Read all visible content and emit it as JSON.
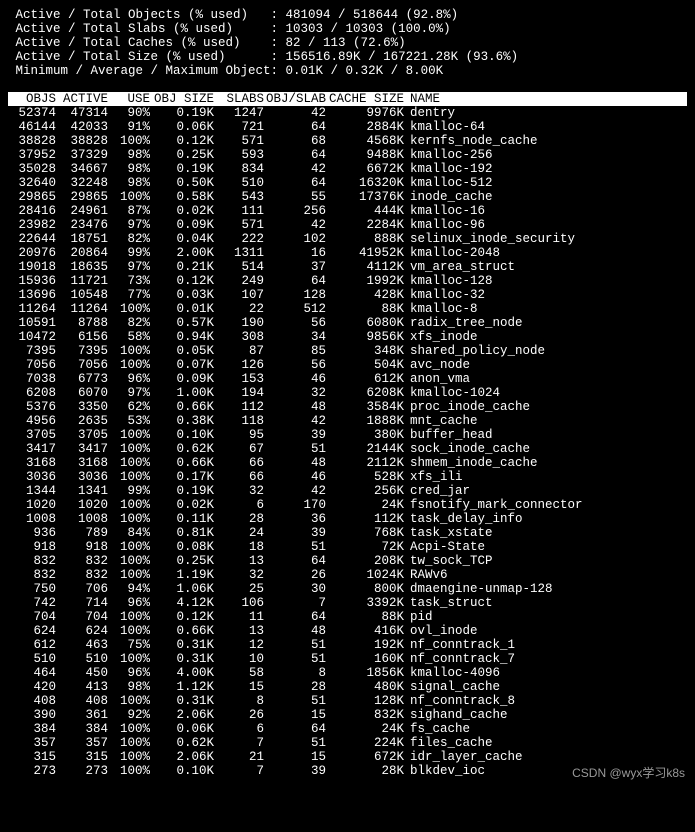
{
  "summary": [
    {
      "label": " Active / Total Objects (% used)   ",
      "value": ": 481094 / 518644 (92.8%)"
    },
    {
      "label": " Active / Total Slabs (% used)     ",
      "value": ": 10303 / 10303 (100.0%)"
    },
    {
      "label": " Active / Total Caches (% used)    ",
      "value": ": 82 / 113 (72.6%)"
    },
    {
      "label": " Active / Total Size (% used)      ",
      "value": ": 156516.89K / 167221.28K (93.6%)"
    },
    {
      "label": " Minimum / Average / Maximum Object",
      "value": ": 0.01K / 0.32K / 8.00K"
    }
  ],
  "headers": {
    "objs": "OBJS",
    "active": "ACTIVE",
    "use": "USE",
    "obj_size": "OBJ SIZE",
    "slabs": "SLABS",
    "obj_slab": "OBJ/SLAB",
    "cache_size": "CACHE SIZE",
    "name": "NAME"
  },
  "rows": [
    {
      "objs": "52374",
      "active": "47314",
      "use": "90%",
      "obj_size": "0.19K",
      "slabs": "1247",
      "obj_slab": "42",
      "cache_size": "9976K",
      "name": "dentry"
    },
    {
      "objs": "46144",
      "active": "42033",
      "use": "91%",
      "obj_size": "0.06K",
      "slabs": "721",
      "obj_slab": "64",
      "cache_size": "2884K",
      "name": "kmalloc-64"
    },
    {
      "objs": "38828",
      "active": "38828",
      "use": "100%",
      "obj_size": "0.12K",
      "slabs": "571",
      "obj_slab": "68",
      "cache_size": "4568K",
      "name": "kernfs_node_cache"
    },
    {
      "objs": "37952",
      "active": "37329",
      "use": "98%",
      "obj_size": "0.25K",
      "slabs": "593",
      "obj_slab": "64",
      "cache_size": "9488K",
      "name": "kmalloc-256"
    },
    {
      "objs": "35028",
      "active": "34667",
      "use": "98%",
      "obj_size": "0.19K",
      "slabs": "834",
      "obj_slab": "42",
      "cache_size": "6672K",
      "name": "kmalloc-192"
    },
    {
      "objs": "32640",
      "active": "32248",
      "use": "98%",
      "obj_size": "0.50K",
      "slabs": "510",
      "obj_slab": "64",
      "cache_size": "16320K",
      "name": "kmalloc-512"
    },
    {
      "objs": "29865",
      "active": "29865",
      "use": "100%",
      "obj_size": "0.58K",
      "slabs": "543",
      "obj_slab": "55",
      "cache_size": "17376K",
      "name": "inode_cache"
    },
    {
      "objs": "28416",
      "active": "24961",
      "use": "87%",
      "obj_size": "0.02K",
      "slabs": "111",
      "obj_slab": "256",
      "cache_size": "444K",
      "name": "kmalloc-16"
    },
    {
      "objs": "23982",
      "active": "23476",
      "use": "97%",
      "obj_size": "0.09K",
      "slabs": "571",
      "obj_slab": "42",
      "cache_size": "2284K",
      "name": "kmalloc-96"
    },
    {
      "objs": "22644",
      "active": "18751",
      "use": "82%",
      "obj_size": "0.04K",
      "slabs": "222",
      "obj_slab": "102",
      "cache_size": "888K",
      "name": "selinux_inode_security"
    },
    {
      "objs": "20976",
      "active": "20864",
      "use": "99%",
      "obj_size": "2.00K",
      "slabs": "1311",
      "obj_slab": "16",
      "cache_size": "41952K",
      "name": "kmalloc-2048"
    },
    {
      "objs": "19018",
      "active": "18635",
      "use": "97%",
      "obj_size": "0.21K",
      "slabs": "514",
      "obj_slab": "37",
      "cache_size": "4112K",
      "name": "vm_area_struct"
    },
    {
      "objs": "15936",
      "active": "11721",
      "use": "73%",
      "obj_size": "0.12K",
      "slabs": "249",
      "obj_slab": "64",
      "cache_size": "1992K",
      "name": "kmalloc-128"
    },
    {
      "objs": "13696",
      "active": "10548",
      "use": "77%",
      "obj_size": "0.03K",
      "slabs": "107",
      "obj_slab": "128",
      "cache_size": "428K",
      "name": "kmalloc-32"
    },
    {
      "objs": "11264",
      "active": "11264",
      "use": "100%",
      "obj_size": "0.01K",
      "slabs": "22",
      "obj_slab": "512",
      "cache_size": "88K",
      "name": "kmalloc-8"
    },
    {
      "objs": "10591",
      "active": "8788",
      "use": "82%",
      "obj_size": "0.57K",
      "slabs": "190",
      "obj_slab": "56",
      "cache_size": "6080K",
      "name": "radix_tree_node"
    },
    {
      "objs": "10472",
      "active": "6156",
      "use": "58%",
      "obj_size": "0.94K",
      "slabs": "308",
      "obj_slab": "34",
      "cache_size": "9856K",
      "name": "xfs_inode"
    },
    {
      "objs": "7395",
      "active": "7395",
      "use": "100%",
      "obj_size": "0.05K",
      "slabs": "87",
      "obj_slab": "85",
      "cache_size": "348K",
      "name": "shared_policy_node"
    },
    {
      "objs": "7056",
      "active": "7056",
      "use": "100%",
      "obj_size": "0.07K",
      "slabs": "126",
      "obj_slab": "56",
      "cache_size": "504K",
      "name": "avc_node"
    },
    {
      "objs": "7038",
      "active": "6773",
      "use": "96%",
      "obj_size": "0.09K",
      "slabs": "153",
      "obj_slab": "46",
      "cache_size": "612K",
      "name": "anon_vma"
    },
    {
      "objs": "6208",
      "active": "6070",
      "use": "97%",
      "obj_size": "1.00K",
      "slabs": "194",
      "obj_slab": "32",
      "cache_size": "6208K",
      "name": "kmalloc-1024"
    },
    {
      "objs": "5376",
      "active": "3350",
      "use": "62%",
      "obj_size": "0.66K",
      "slabs": "112",
      "obj_slab": "48",
      "cache_size": "3584K",
      "name": "proc_inode_cache"
    },
    {
      "objs": "4956",
      "active": "2635",
      "use": "53%",
      "obj_size": "0.38K",
      "slabs": "118",
      "obj_slab": "42",
      "cache_size": "1888K",
      "name": "mnt_cache"
    },
    {
      "objs": "3705",
      "active": "3705",
      "use": "100%",
      "obj_size": "0.10K",
      "slabs": "95",
      "obj_slab": "39",
      "cache_size": "380K",
      "name": "buffer_head"
    },
    {
      "objs": "3417",
      "active": "3417",
      "use": "100%",
      "obj_size": "0.62K",
      "slabs": "67",
      "obj_slab": "51",
      "cache_size": "2144K",
      "name": "sock_inode_cache"
    },
    {
      "objs": "3168",
      "active": "3168",
      "use": "100%",
      "obj_size": "0.66K",
      "slabs": "66",
      "obj_slab": "48",
      "cache_size": "2112K",
      "name": "shmem_inode_cache"
    },
    {
      "objs": "3036",
      "active": "3036",
      "use": "100%",
      "obj_size": "0.17K",
      "slabs": "66",
      "obj_slab": "46",
      "cache_size": "528K",
      "name": "xfs_ili"
    },
    {
      "objs": "1344",
      "active": "1341",
      "use": "99%",
      "obj_size": "0.19K",
      "slabs": "32",
      "obj_slab": "42",
      "cache_size": "256K",
      "name": "cred_jar"
    },
    {
      "objs": "1020",
      "active": "1020",
      "use": "100%",
      "obj_size": "0.02K",
      "slabs": "6",
      "obj_slab": "170",
      "cache_size": "24K",
      "name": "fsnotify_mark_connector"
    },
    {
      "objs": "1008",
      "active": "1008",
      "use": "100%",
      "obj_size": "0.11K",
      "slabs": "28",
      "obj_slab": "36",
      "cache_size": "112K",
      "name": "task_delay_info"
    },
    {
      "objs": "936",
      "active": "789",
      "use": "84%",
      "obj_size": "0.81K",
      "slabs": "24",
      "obj_slab": "39",
      "cache_size": "768K",
      "name": "task_xstate"
    },
    {
      "objs": "918",
      "active": "918",
      "use": "100%",
      "obj_size": "0.08K",
      "slabs": "18",
      "obj_slab": "51",
      "cache_size": "72K",
      "name": "Acpi-State"
    },
    {
      "objs": "832",
      "active": "832",
      "use": "100%",
      "obj_size": "0.25K",
      "slabs": "13",
      "obj_slab": "64",
      "cache_size": "208K",
      "name": "tw_sock_TCP"
    },
    {
      "objs": "832",
      "active": "832",
      "use": "100%",
      "obj_size": "1.19K",
      "slabs": "32",
      "obj_slab": "26",
      "cache_size": "1024K",
      "name": "RAWv6"
    },
    {
      "objs": "750",
      "active": "706",
      "use": "94%",
      "obj_size": "1.06K",
      "slabs": "25",
      "obj_slab": "30",
      "cache_size": "800K",
      "name": "dmaengine-unmap-128"
    },
    {
      "objs": "742",
      "active": "714",
      "use": "96%",
      "obj_size": "4.12K",
      "slabs": "106",
      "obj_slab": "7",
      "cache_size": "3392K",
      "name": "task_struct"
    },
    {
      "objs": "704",
      "active": "704",
      "use": "100%",
      "obj_size": "0.12K",
      "slabs": "11",
      "obj_slab": "64",
      "cache_size": "88K",
      "name": "pid"
    },
    {
      "objs": "624",
      "active": "624",
      "use": "100%",
      "obj_size": "0.66K",
      "slabs": "13",
      "obj_slab": "48",
      "cache_size": "416K",
      "name": "ovl_inode"
    },
    {
      "objs": "612",
      "active": "463",
      "use": "75%",
      "obj_size": "0.31K",
      "slabs": "12",
      "obj_slab": "51",
      "cache_size": "192K",
      "name": "nf_conntrack_1"
    },
    {
      "objs": "510",
      "active": "510",
      "use": "100%",
      "obj_size": "0.31K",
      "slabs": "10",
      "obj_slab": "51",
      "cache_size": "160K",
      "name": "nf_conntrack_7"
    },
    {
      "objs": "464",
      "active": "450",
      "use": "96%",
      "obj_size": "4.00K",
      "slabs": "58",
      "obj_slab": "8",
      "cache_size": "1856K",
      "name": "kmalloc-4096"
    },
    {
      "objs": "420",
      "active": "413",
      "use": "98%",
      "obj_size": "1.12K",
      "slabs": "15",
      "obj_slab": "28",
      "cache_size": "480K",
      "name": "signal_cache"
    },
    {
      "objs": "408",
      "active": "408",
      "use": "100%",
      "obj_size": "0.31K",
      "slabs": "8",
      "obj_slab": "51",
      "cache_size": "128K",
      "name": "nf_conntrack_8"
    },
    {
      "objs": "390",
      "active": "361",
      "use": "92%",
      "obj_size": "2.06K",
      "slabs": "26",
      "obj_slab": "15",
      "cache_size": "832K",
      "name": "sighand_cache"
    },
    {
      "objs": "384",
      "active": "384",
      "use": "100%",
      "obj_size": "0.06K",
      "slabs": "6",
      "obj_slab": "64",
      "cache_size": "24K",
      "name": "fs_cache"
    },
    {
      "objs": "357",
      "active": "357",
      "use": "100%",
      "obj_size": "0.62K",
      "slabs": "7",
      "obj_slab": "51",
      "cache_size": "224K",
      "name": "files_cache"
    },
    {
      "objs": "315",
      "active": "315",
      "use": "100%",
      "obj_size": "2.06K",
      "slabs": "21",
      "obj_slab": "15",
      "cache_size": "672K",
      "name": "idr_layer_cache"
    },
    {
      "objs": "273",
      "active": "273",
      "use": "100%",
      "obj_size": "0.10K",
      "slabs": "7",
      "obj_slab": "39",
      "cache_size": "28K",
      "name": "blkdev_ioc"
    }
  ],
  "watermark": "CSDN @wyx学习k8s"
}
